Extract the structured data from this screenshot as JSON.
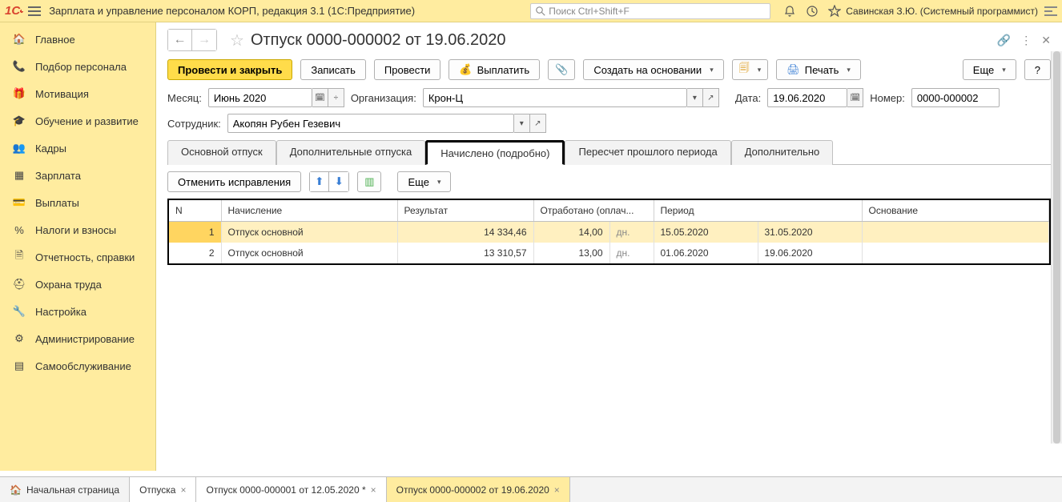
{
  "app": {
    "title": "Зарплата и управление персоналом КОРП, редакция 3.1  (1С:Предприятие)",
    "search_placeholder": "Поиск Ctrl+Shift+F",
    "user": "Савинская З.Ю. (Системный программист)"
  },
  "nav": {
    "items": [
      {
        "label": "Главное"
      },
      {
        "label": "Подбор персонала"
      },
      {
        "label": "Мотивация"
      },
      {
        "label": "Обучение и развитие"
      },
      {
        "label": "Кадры"
      },
      {
        "label": "Зарплата"
      },
      {
        "label": "Выплаты"
      },
      {
        "label": "Налоги и взносы"
      },
      {
        "label": "Отчетность, справки"
      },
      {
        "label": "Охрана труда"
      },
      {
        "label": "Настройка"
      },
      {
        "label": "Администрирование"
      },
      {
        "label": "Самообслуживание"
      }
    ]
  },
  "doc": {
    "title": "Отпуск 0000-000002 от 19.06.2020",
    "buttons": {
      "post_close": "Провести и закрыть",
      "save": "Записать",
      "post": "Провести",
      "pay": "Выплатить",
      "create_based": "Создать на основании",
      "print": "Печать",
      "more": "Еще",
      "help": "?"
    },
    "labels": {
      "month": "Месяц:",
      "org": "Организация:",
      "date": "Дата:",
      "number": "Номер:",
      "employee": "Сотрудник:"
    },
    "values": {
      "month": "Июнь 2020",
      "org": "Крон-Ц",
      "date": "19.06.2020",
      "number": "0000-000002",
      "employee": "Акопян Рубен Гезевич"
    },
    "tabs": [
      {
        "label": "Основной отпуск"
      },
      {
        "label": "Дополнительные отпуска"
      },
      {
        "label": "Начислено (подробно)"
      },
      {
        "label": "Пересчет прошлого периода"
      },
      {
        "label": "Дополнительно"
      }
    ],
    "tabtools": {
      "undo": "Отменить исправления",
      "more": "Еще"
    },
    "grid": {
      "headers": {
        "n": "N",
        "accrual": "Начисление",
        "result": "Результат",
        "worked": "Отработано (оплач...",
        "period": "Период",
        "basis": "Основание"
      },
      "rows": [
        {
          "n": "1",
          "accrual": "Отпуск основной",
          "result": "14 334,46",
          "worked": "14,00",
          "unit": "дн.",
          "from": "15.05.2020",
          "to": "31.05.2020"
        },
        {
          "n": "2",
          "accrual": "Отпуск основной",
          "result": "13 310,57",
          "worked": "13,00",
          "unit": "дн.",
          "from": "01.06.2020",
          "to": "19.06.2020"
        }
      ]
    }
  },
  "bottom": {
    "home": "Начальная страница",
    "tabs": [
      {
        "label": "Отпуска",
        "closable": true
      },
      {
        "label": "Отпуск 0000-000001 от 12.05.2020 *",
        "closable": true
      },
      {
        "label": "Отпуск 0000-000002 от 19.06.2020",
        "closable": true,
        "active": true
      }
    ]
  }
}
